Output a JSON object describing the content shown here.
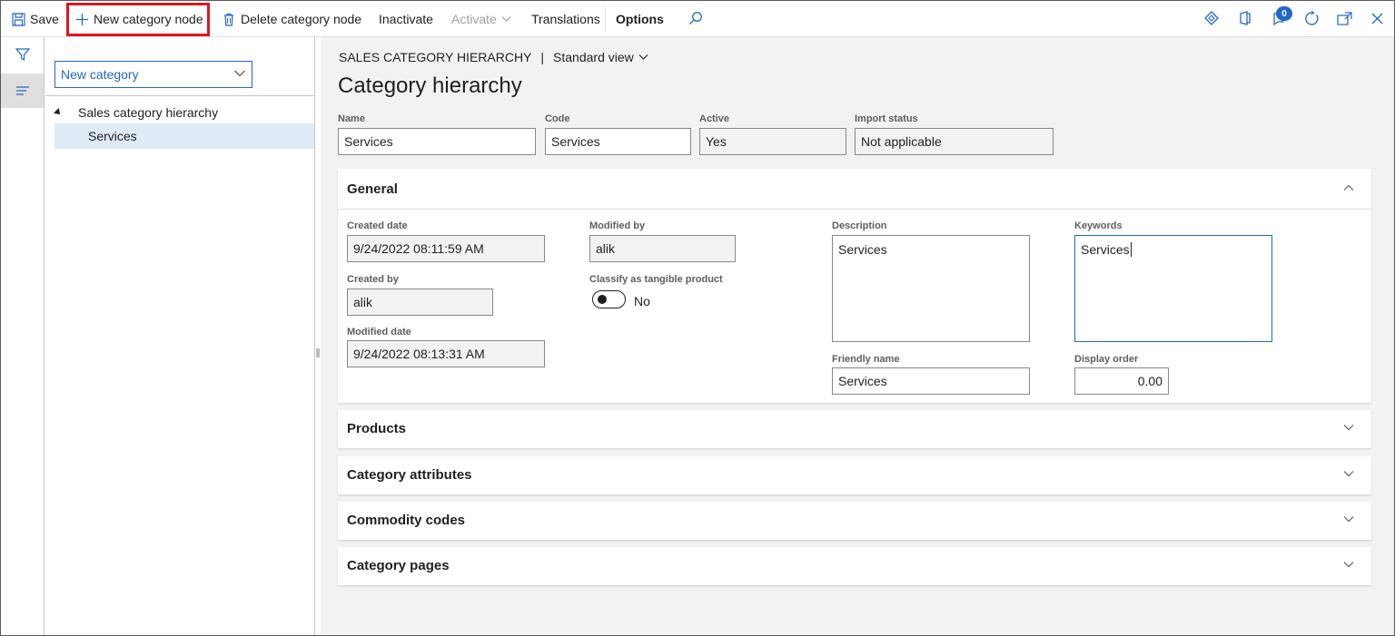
{
  "toolbar": {
    "save": "Save",
    "new_category_node": "New category node",
    "delete_category_node": "Delete category node",
    "inactivate": "Inactivate",
    "activate": "Activate",
    "translations": "Translations",
    "options": "Options",
    "notification_count": "0",
    "highlight_color": "#e0161e"
  },
  "tree": {
    "dropdown_value": "New category",
    "root": "Sales category hierarchy",
    "child": "Services"
  },
  "header": {
    "breadcrumb": "SALES CATEGORY HIERARCHY",
    "view": "Standard view",
    "title": "Category hierarchy"
  },
  "fields": {
    "name_label": "Name",
    "name_value": "Services",
    "code_label": "Code",
    "code_value": "Services",
    "active_label": "Active",
    "active_value": "Yes",
    "import_label": "Import status",
    "import_value": "Not applicable"
  },
  "general": {
    "title": "General",
    "created_date_label": "Created date",
    "created_date_value": "9/24/2022 08:11:59 AM",
    "created_by_label": "Created by",
    "created_by_value": "alik",
    "modified_date_label": "Modified date",
    "modified_date_value": "9/24/2022 08:13:31 AM",
    "modified_by_label": "Modified by",
    "modified_by_value": "alik",
    "tangible_label": "Classify as tangible product",
    "tangible_value": "No",
    "description_label": "Description",
    "description_value": "Services",
    "keywords_label": "Keywords",
    "keywords_value": "Services",
    "friendly_label": "Friendly name",
    "friendly_value": "Services",
    "display_order_label": "Display order",
    "display_order_value": "0.00"
  },
  "sections": {
    "products": "Products",
    "category_attributes": "Category attributes",
    "commodity_codes": "Commodity codes",
    "category_pages": "Category pages"
  },
  "colors": {
    "accent": "#2266c9",
    "selection": "#deebf7",
    "content_bg": "#f3f2f1"
  }
}
